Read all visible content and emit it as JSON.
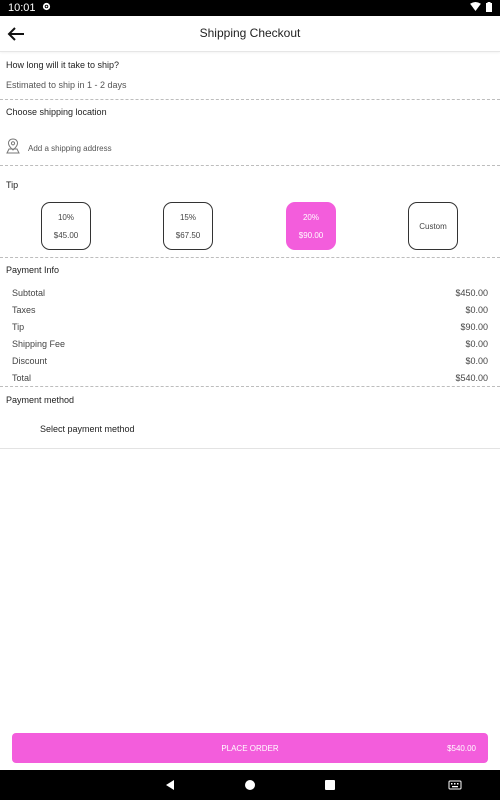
{
  "status_bar": {
    "time": "10:01"
  },
  "header": {
    "title": "Shipping Checkout"
  },
  "shipping_time": {
    "question": "How long will it take to ship?",
    "estimate": "Estimated to ship in 1 - 2 days"
  },
  "location": {
    "label": "Choose shipping location",
    "placeholder": "Add a shipping address"
  },
  "tip": {
    "label": "Tip",
    "options": [
      {
        "percent": "10%",
        "amount": "$45.00",
        "selected": false
      },
      {
        "percent": "15%",
        "amount": "$67.50",
        "selected": false
      },
      {
        "percent": "20%",
        "amount": "$90.00",
        "selected": true
      },
      {
        "label": "Custom",
        "selected": false
      }
    ]
  },
  "payment_info": {
    "label": "Payment Info",
    "rows": [
      {
        "name": "Subtotal",
        "value": "$450.00"
      },
      {
        "name": "Taxes",
        "value": "$0.00"
      },
      {
        "name": "Tip",
        "value": "$90.00"
      },
      {
        "name": "Shipping Fee",
        "value": "$0.00"
      },
      {
        "name": "Discount",
        "value": "$0.00"
      },
      {
        "name": "Total",
        "value": "$540.00"
      }
    ]
  },
  "payment_method": {
    "label": "Payment method",
    "select_text": "Select payment method"
  },
  "place_order": {
    "label": "PLACE ORDER",
    "amount": "$540.00"
  },
  "colors": {
    "accent": "#f35ddc"
  },
  "icons": [
    "settings-icon",
    "wifi-icon",
    "battery-icon",
    "back-arrow-icon",
    "location-pin-icon",
    "nav-back-icon",
    "nav-home-icon",
    "nav-recents-icon",
    "keyboard-icon"
  ]
}
